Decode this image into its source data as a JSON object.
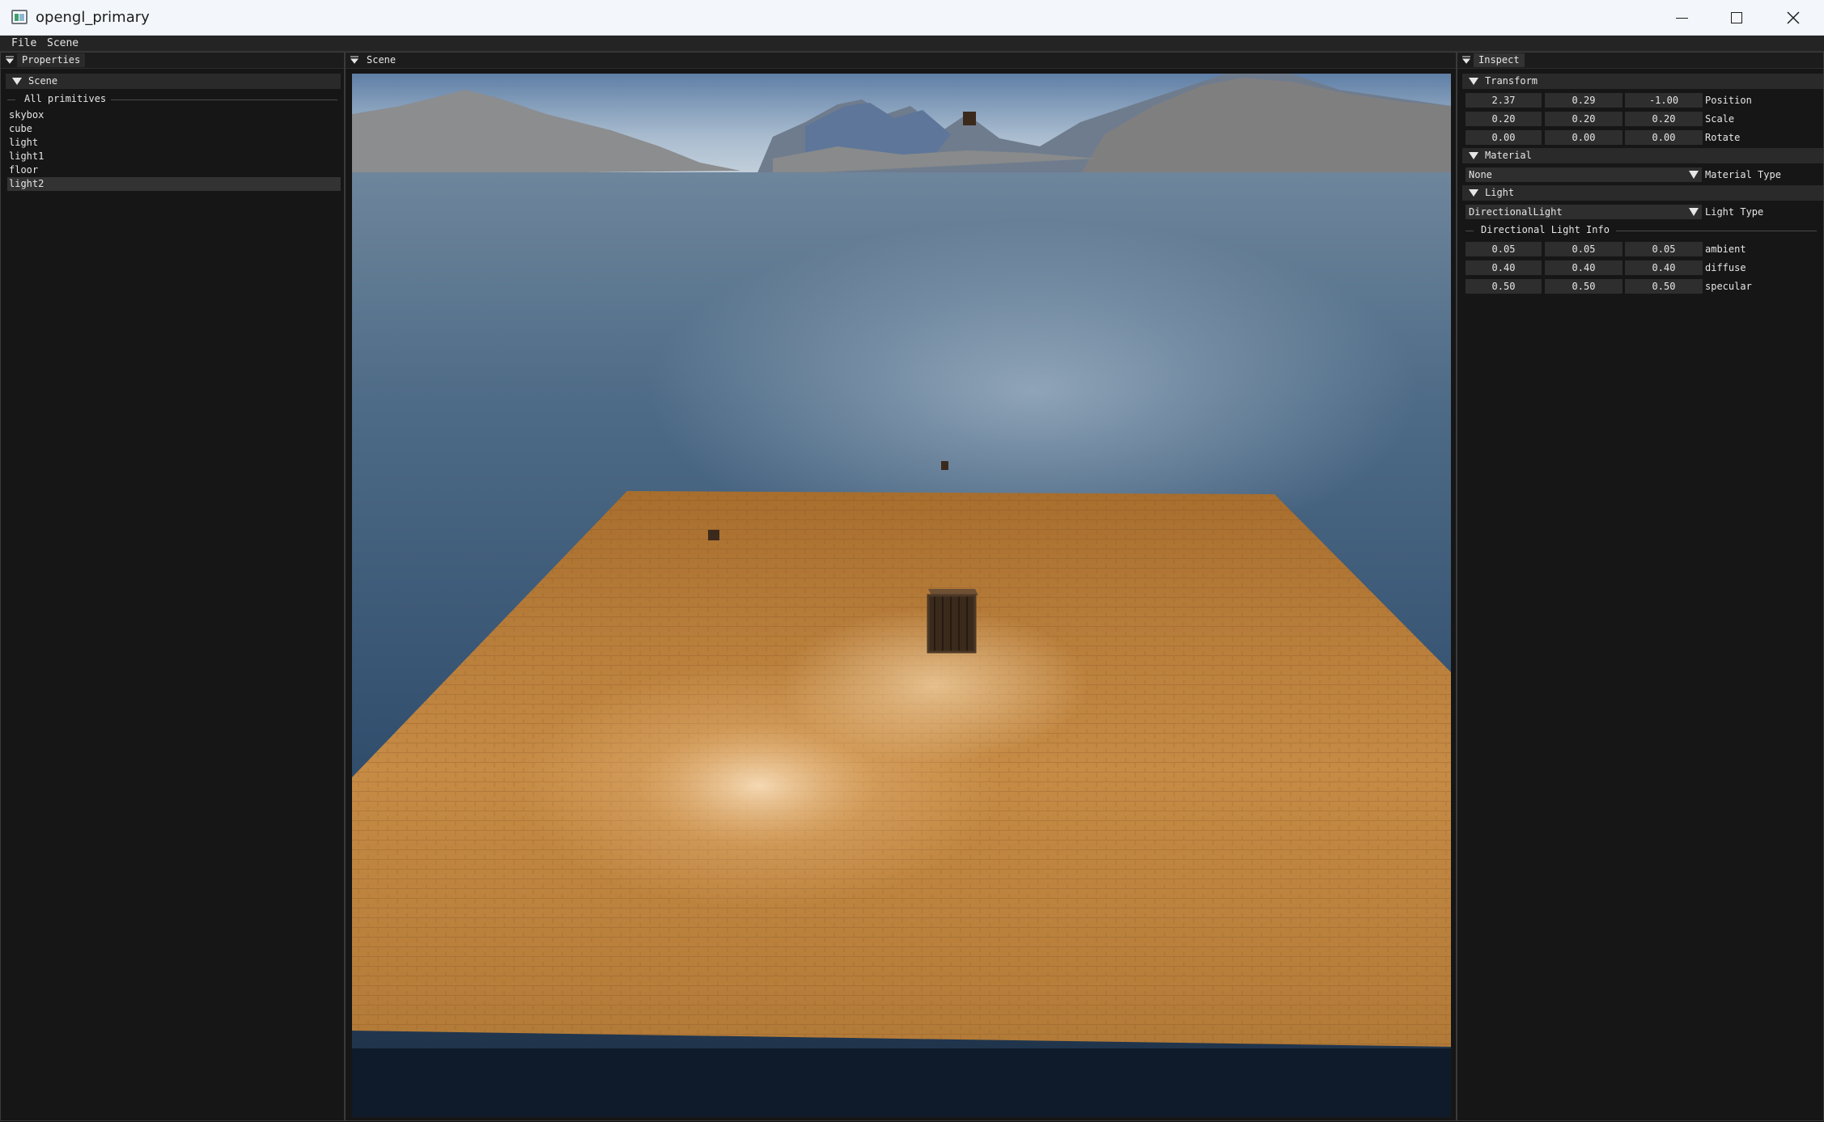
{
  "window": {
    "title": "opengl_primary"
  },
  "menu": {
    "file": "File",
    "scene": "Scene"
  },
  "left_panel": {
    "tab": "Properties",
    "section": "Scene",
    "group_label": "All primitives",
    "items": [
      {
        "label": "skybox",
        "selected": false
      },
      {
        "label": "cube",
        "selected": false
      },
      {
        "label": "light",
        "selected": false
      },
      {
        "label": "light1",
        "selected": false
      },
      {
        "label": "floor",
        "selected": false
      },
      {
        "label": "light2",
        "selected": true
      }
    ]
  },
  "center_panel": {
    "tab": "Scene"
  },
  "inspect": {
    "tab": "Inspect",
    "transform": {
      "header": "Transform",
      "rows": [
        {
          "label": "Position",
          "values": [
            "2.37",
            "0.29",
            "-1.00"
          ]
        },
        {
          "label": "Scale",
          "values": [
            "0.20",
            "0.20",
            "0.20"
          ]
        },
        {
          "label": "Rotate",
          "values": [
            "0.00",
            "0.00",
            "0.00"
          ]
        }
      ]
    },
    "material": {
      "header": "Material",
      "value": "None",
      "label": "Material Type"
    },
    "light": {
      "header": "Light",
      "value": "DirectionalLight",
      "label": "Light Type",
      "info_label": "Directional Light Info",
      "rows": [
        {
          "label": "ambient",
          "values": [
            "0.05",
            "0.05",
            "0.05"
          ]
        },
        {
          "label": "diffuse",
          "values": [
            "0.40",
            "0.40",
            "0.40"
          ]
        },
        {
          "label": "specular",
          "values": [
            "0.50",
            "0.50",
            "0.50"
          ]
        }
      ]
    }
  },
  "colors": {
    "panel_bg": "#161616",
    "header_bg": "#2a2a2a",
    "field_bg": "#2e2e2e",
    "floor": "#c9893e",
    "water": "#3d5a78"
  }
}
